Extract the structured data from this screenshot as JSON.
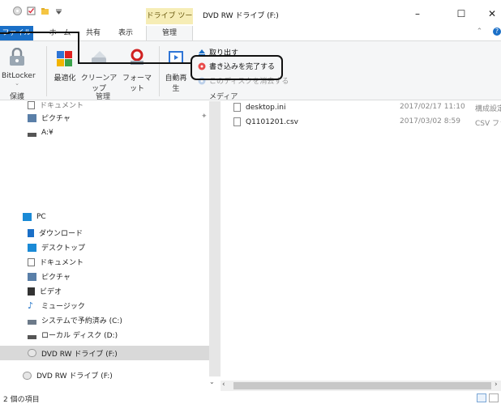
{
  "window": {
    "context_tab_label": "ドライブ ツール",
    "title": "DVD RW ドライブ (F:)",
    "minimize": "–",
    "maximize": "☐",
    "close": "✕"
  },
  "tabs": {
    "file": "ファイル",
    "home": "ホーム",
    "share": "共有",
    "view": "表示",
    "manage": "管理",
    "right_glyph": "⌃",
    "help_glyph": "?"
  },
  "ribbon": {
    "bitlocker": "BitLocker",
    "optimize": "最適化",
    "cleanup": "クリーンアップ",
    "format": "フォーマット",
    "autoplay": "自動再生",
    "eject": "取り出す",
    "finish_burning": "書き込みを完了する",
    "erase_disc": "このディスクを消去する",
    "group_protect": "保護",
    "group_manage": "管理",
    "group_media": "メディア"
  },
  "nav": {
    "documents_partial": "ドキュメント",
    "pictures": "ピクチャ",
    "a_drive": "A:¥",
    "pc": "PC",
    "downloads": "ダウンロード",
    "desktop": "デスクトップ",
    "documents": "ドキュメント",
    "pictures2": "ピクチャ",
    "videos": "ビデオ",
    "music": "ミュージック",
    "system_reserved": "システムで予約済み (C:)",
    "local_disk": "ローカル ディスク (D:)",
    "dvd_drive": "DVD RW ドライブ (F:)",
    "dvd_drive2": "DVD RW ドライブ (F:)"
  },
  "files": [
    {
      "name": "desktop.ini",
      "date": "2017/02/17 11:10",
      "type": "構成設定"
    },
    {
      "name": "Q1101201.csv",
      "date": "2017/03/02 8:59",
      "type": "CSV ファイル"
    }
  ],
  "status": {
    "item_count": "2 個の項目"
  },
  "colors": {
    "file_tab": "#1a6fc7",
    "context_tab": "#f6edb6",
    "ribbon_bg": "#f5f6f7",
    "selected_nav": "#d9d9d9"
  }
}
